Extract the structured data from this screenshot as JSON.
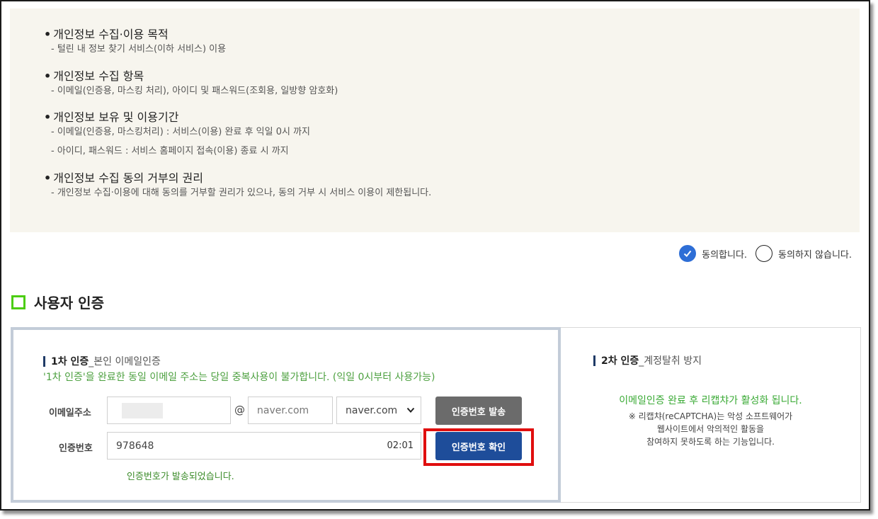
{
  "privacy": {
    "sections": [
      {
        "title": "개인정보 수집·이용 목적",
        "lines": [
          "- 털린 내 정보 찾기 서비스(이하 서비스) 이용"
        ]
      },
      {
        "title": "개인정보 수집 항목",
        "lines": [
          "- 이메일(인증용, 마스킹 처리), 아이디 및 패스워드(조회용, 일방향 암호화)"
        ]
      },
      {
        "title": "개인정보 보유 및 이용기간",
        "lines": [
          "- 이메일(인증용, 마스킹처리) : 서비스(이용) 완료 후 익일 0시 까지",
          "- 아이디, 패스워드 : 서비스 홈페이지 접속(이용) 종료 시 까지"
        ]
      },
      {
        "title": "개인정보 수집 동의 거부의 권리",
        "lines": [
          "- 개인정보 수집·이용에 대해 동의를 거부할 권리가 있으나, 동의 거부 시 서비스 이용이 제한됩니다."
        ]
      }
    ]
  },
  "consent": {
    "agree_label": "동의합니다.",
    "disagree_label": "동의하지 않습니다.",
    "selected": "agree",
    "accent_color": "#2e6ed6"
  },
  "auth": {
    "title": "사용자 인증",
    "step1": {
      "title_bold": "1차 인증",
      "title_rest": "_본인 이메일인증",
      "notice": "'1차 인증'을 완료한 동일 이메일 주소는 당일 중복사용이 불가합니다. (익일 0시부터 사용가능)",
      "email_label": "이메일주소",
      "at_symbol": "@",
      "domain_placeholder": "naver.com",
      "domain_select": "naver.com",
      "send_button": "인증번호 발송",
      "code_label": "인증번호",
      "code_value": "978648",
      "timer": "02:01",
      "confirm_button": "인증번호 확인",
      "sent_message": "인증번호가 발송되었습니다."
    },
    "step2": {
      "title_bold": "2차 인증",
      "title_rest": "_계정탈취 방지",
      "message": "이메일인증 완료 후 리캡챠가 활성화 됩니다.",
      "desc_lines": [
        "※ 리캡챠(reCAPTCHA)는 악성 소프트웨어가",
        "웹사이트에서 악의적인 활동을",
        "참여하지 못하도록 하는 기능입니다."
      ]
    }
  }
}
